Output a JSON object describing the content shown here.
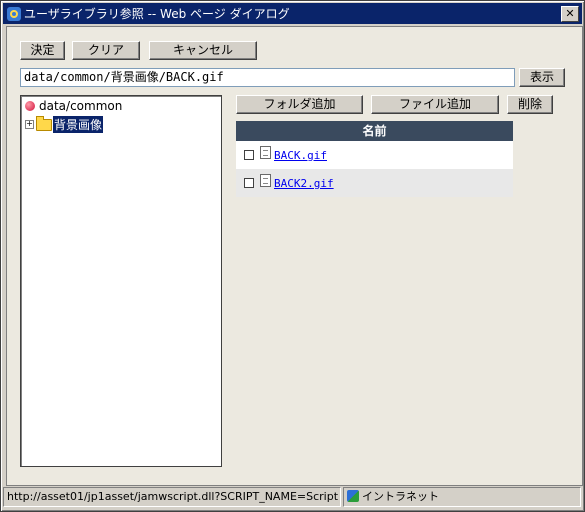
{
  "window": {
    "title": "ユーザライブラリ参照 -- Web ページ ダイアログ",
    "close_label": "✕"
  },
  "toolbar": {
    "ok_label": "決定",
    "clear_label": "クリア",
    "cancel_label": "キャンセル"
  },
  "path": {
    "value": "data/common/背景画像/BACK.gif",
    "show_label": "表示"
  },
  "tree": {
    "root_label": "data/common",
    "children": [
      {
        "label": "背景画像",
        "expander": "+",
        "selected": true
      }
    ]
  },
  "file_actions": {
    "add_folder_label": "フォルダ追加",
    "add_file_label": "ファイル追加",
    "delete_label": "削除"
  },
  "file_table": {
    "header": "名前",
    "rows": [
      {
        "name": "BACK.gif"
      },
      {
        "name": "BACK2.gif"
      }
    ]
  },
  "status": {
    "url": "http://asset01/jp1asset/jamwscript.dll?SCRIPT_NAME=Script",
    "zone": "イントラネット"
  }
}
